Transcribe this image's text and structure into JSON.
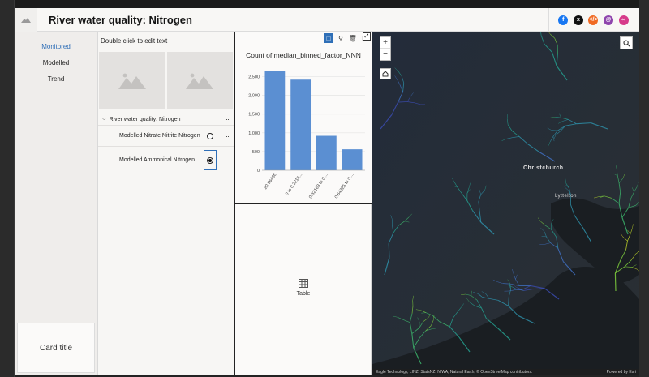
{
  "header": {
    "title": "River water quality: Nitrogen",
    "share": [
      {
        "icon": "facebook-icon",
        "color": "#1877f2",
        "glyph": "f"
      },
      {
        "icon": "x-icon",
        "color": "#111111",
        "glyph": "x"
      },
      {
        "icon": "embed-icon",
        "color": "#f06a24",
        "glyph": "</>"
      },
      {
        "icon": "email-icon",
        "color": "#8e44ad",
        "glyph": "@"
      },
      {
        "icon": "link-icon",
        "color": "#d63a8a",
        "glyph": "∞"
      }
    ]
  },
  "nav": {
    "items": [
      {
        "label": "Monitored",
        "active": true
      },
      {
        "label": "Modelled",
        "active": false
      },
      {
        "label": "Trend",
        "active": false
      }
    ],
    "card_title": "Card title"
  },
  "layers": {
    "edit_text": "Double click to edit text",
    "group_label": "River water quality: Nitrogen",
    "items": [
      {
        "label": "Modelled Nitrate Nitrite Nitrogen",
        "selected": false
      },
      {
        "label": "Modelled Ammonical Nitrogen",
        "selected": true
      }
    ]
  },
  "chart_data": {
    "type": "bar",
    "title": "Count of median_binned_factor_NNN",
    "categories": [
      "≥0.96466",
      "0 to 0.3216...",
      "0.32163 to 0....",
      "0.64325 to 0...."
    ],
    "values": [
      2650,
      2420,
      920,
      560
    ],
    "ylim": [
      0,
      2750
    ],
    "yticks": [
      0,
      500,
      1000,
      1500,
      2000,
      2500
    ],
    "ytick_labels": [
      "0",
      "500",
      "1,000",
      "1,500",
      "2,000",
      "2,500"
    ],
    "bar_color": "#5b8fd2",
    "grid": true
  },
  "table_panel": {
    "label": "Table"
  },
  "map": {
    "places": [
      "Christchurch",
      "Lyttelton"
    ],
    "attribution": "Eagle Technology, LINZ, StatsNZ, NIWA, Natural Earth, © OpenStreetMap contributors.",
    "powered_by": "Powered by Esri"
  }
}
